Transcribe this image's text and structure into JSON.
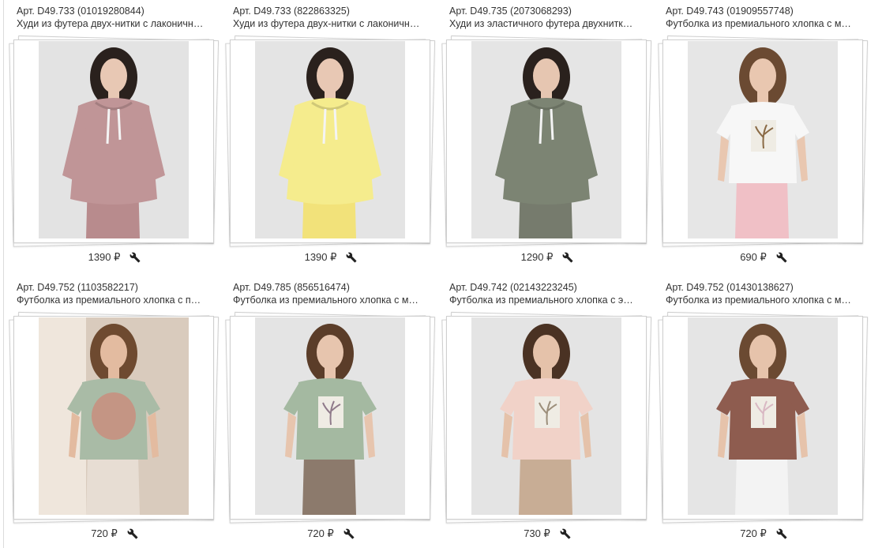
{
  "colors": {
    "frame": "#dcdcdc",
    "text": "#333333"
  },
  "products": [
    {
      "sku": "Арт. D49.733 (01019280844)",
      "title": "Худи из футера двух-нитки с лаконичн…",
      "price": "1390 ₽",
      "garment": "hoodie",
      "top_color": "#c09597",
      "bottom_color": "#b88b8d",
      "bg": "#e3e3e3",
      "hair": "#2a211d",
      "skin": "#e8c8b4",
      "print": "",
      "icon": "wrench-icon"
    },
    {
      "sku": "Арт. D49.733 (822863325)",
      "title": "Худи из футера двух-нитки с лаконичн…",
      "price": "1390 ₽",
      "garment": "hoodie",
      "top_color": "#f5ec8d",
      "bottom_color": "#f2e27a",
      "bg": "#e4e4e4",
      "hair": "#2a211d",
      "skin": "#e8c8b4",
      "print": "",
      "icon": "wrench-icon"
    },
    {
      "sku": "Арт. D49.735 (2073068293)",
      "title": "Худи из эластичного футера двухнитк…",
      "price": "1290 ₽",
      "garment": "hoodie",
      "top_color": "#7c8473",
      "bottom_color": "#767b6d",
      "bg": "#e5e5e5",
      "hair": "#2a211d",
      "skin": "#e6c6b1",
      "print": "",
      "icon": "wrench-icon"
    },
    {
      "sku": "Арт. D49.743 (01909557748)",
      "title": "Футболка из премиального хлопка с м…",
      "price": "690 ₽",
      "garment": "tee",
      "top_color": "#f7f7f7",
      "bottom_color": "#f0c0c6",
      "bg": "#e6e6e6",
      "hair": "#6b4a32",
      "skin": "#e9c7b0",
      "print": "#8a6a45",
      "icon": "wrench-icon"
    },
    {
      "sku": "Арт. D49.752 (1103582217)",
      "title": "Футболка из премиального хлопка с п…",
      "price": "720 ₽",
      "garment": "tee-back",
      "top_color": "#a9bba6",
      "bottom_color": "#e7ddd3",
      "bg": "#d9cbbd",
      "hair": "#6e4a30",
      "skin": "#e3bba0",
      "print": "#c98e7e",
      "icon": "wrench-icon"
    },
    {
      "sku": "Арт. D49.785 (856516474)",
      "title": "Футболка из премиального хлопка с м…",
      "price": "720 ₽",
      "garment": "tee",
      "top_color": "#a4b9a1",
      "bottom_color": "#8c7a6c",
      "bg": "#e4e4e4",
      "hair": "#5b3d29",
      "skin": "#e7c5ae",
      "print": "#8f7a8a",
      "icon": "wrench-icon"
    },
    {
      "sku": "Арт. D49.742 (02143223245)",
      "title": "Футболка из премиального хлопка с э…",
      "price": "730 ₽",
      "garment": "tee",
      "top_color": "#f1d2c8",
      "bottom_color": "#c8ad95",
      "bg": "#e4e4e4",
      "hair": "#4a3223",
      "skin": "#e5c2aa",
      "print": "#9c8e7a",
      "icon": "wrench-icon"
    },
    {
      "sku": "Арт. D49.752 (01430138627)",
      "title": "Футболка из премиального хлопка с м…",
      "price": "720 ₽",
      "garment": "tee",
      "top_color": "#8e5c4f",
      "bottom_color": "#f3f3f3",
      "bg": "#e5e5e5",
      "hair": "#6b4a32",
      "skin": "#e6c3ab",
      "print": "#d9b8c3",
      "icon": "wrench-icon"
    }
  ]
}
